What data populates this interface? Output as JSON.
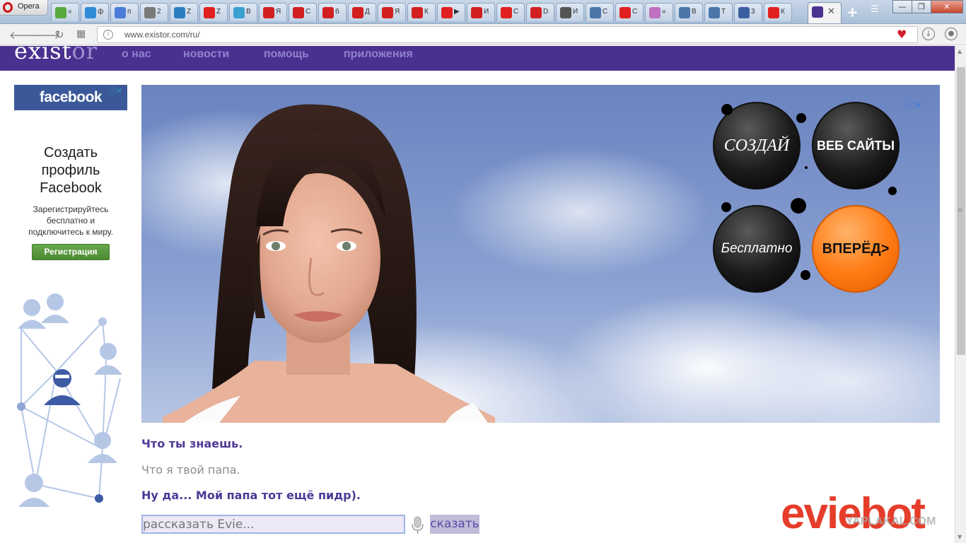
{
  "browser": {
    "app_name": "Opera",
    "tabs": [
      {
        "title": "«",
        "icon": "wrench-icon",
        "color": "#59a83b"
      },
      {
        "title": "ф",
        "icon": "mail-icon",
        "color": "#2f8ad8"
      },
      {
        "title": "п",
        "icon": "google-icon",
        "color": "#4a7bd9"
      },
      {
        "title": "2",
        "icon": "document-icon",
        "color": "#7a7a7a"
      },
      {
        "title": "Z",
        "icon": "tool-icon",
        "color": "#2b7fbe"
      },
      {
        "title": "Z",
        "icon": "lips-icon",
        "color": "#e01f1f"
      },
      {
        "title": "В",
        "icon": "people-icon",
        "color": "#3aa0d0"
      },
      {
        "title": "Я",
        "icon": "yap-icon",
        "color": "#d21f1f"
      },
      {
        "title": "С",
        "icon": "yap-icon",
        "color": "#d21f1f"
      },
      {
        "title": "б",
        "icon": "yap-icon",
        "color": "#d21f1f"
      },
      {
        "title": "Д",
        "icon": "yap-icon",
        "color": "#d21f1f"
      },
      {
        "title": "Я",
        "icon": "yap-icon",
        "color": "#d21f1f"
      },
      {
        "title": "К",
        "icon": "yap-icon",
        "color": "#d21f1f"
      },
      {
        "title": "▶",
        "icon": "youtube-icon",
        "color": "#e02020"
      },
      {
        "title": "И",
        "icon": "yap-icon",
        "color": "#d21f1f"
      },
      {
        "title": "С",
        "icon": "youtube-icon",
        "color": "#e02020"
      },
      {
        "title": "D",
        "icon": "d-icon",
        "color": "#d12020"
      },
      {
        "title": "И",
        "icon": "speaker-icon",
        "color": "#555555"
      },
      {
        "title": "С",
        "icon": "vk-icon",
        "color": "#4a76a8"
      },
      {
        "title": "С",
        "icon": "youtube-icon",
        "color": "#e02020"
      },
      {
        "title": "«",
        "icon": "pinwheel-icon",
        "color": "#c070c0"
      },
      {
        "title": "В",
        "icon": "vk-icon",
        "color": "#4a76a8"
      },
      {
        "title": "Т",
        "icon": "vk-icon",
        "color": "#4a76a8"
      },
      {
        "title": "3",
        "icon": "person-icon",
        "color": "#3b5fa0"
      },
      {
        "title": "К",
        "icon": "youtube-icon",
        "color": "#e02020"
      },
      {
        "title": "",
        "icon": "e-icon",
        "color": "#4a3190",
        "active": true
      }
    ],
    "url": "www.existor.com/ru/",
    "window_buttons": {
      "minimize": "—",
      "maximize": "❐",
      "close": "✕"
    }
  },
  "site": {
    "logo": {
      "main": "exist",
      "accent": "or"
    },
    "nav": [
      "о нас",
      "новости",
      "помощь",
      "приложения"
    ]
  },
  "fb_ad": {
    "brand": "facebook",
    "heading_lines": [
      "Создать",
      "профиль",
      "Facebook"
    ],
    "subtext_lines": [
      "Зарегистрируйтесь",
      "бесплатно и",
      "подключитесь к миру."
    ],
    "button": "Регистрация"
  },
  "banner_ad": {
    "circle_1": "СОЗДАЙ",
    "circle_2": "ВЕБ САЙТЫ",
    "circle_3": "Бесплатно",
    "circle_4": "ВПЕРЁД>"
  },
  "conversation": [
    {
      "speaker": "bot",
      "text": "Что ты знаешь."
    },
    {
      "speaker": "user",
      "text": "Что я твой папа."
    },
    {
      "speaker": "bot",
      "text": "Ну да... Мой папа тот ещё пидр)."
    }
  ],
  "input": {
    "placeholder": "рассказать Evie..."
  },
  "say_button": "сказать",
  "brand_logo": "eviebot",
  "watermark": "YAPLAKAL.COM",
  "colors": {
    "site_header": "#4a3190",
    "bot_text": "#4e3996",
    "eviebot": "#e53d2a",
    "fb_blue": "#3b5998"
  }
}
